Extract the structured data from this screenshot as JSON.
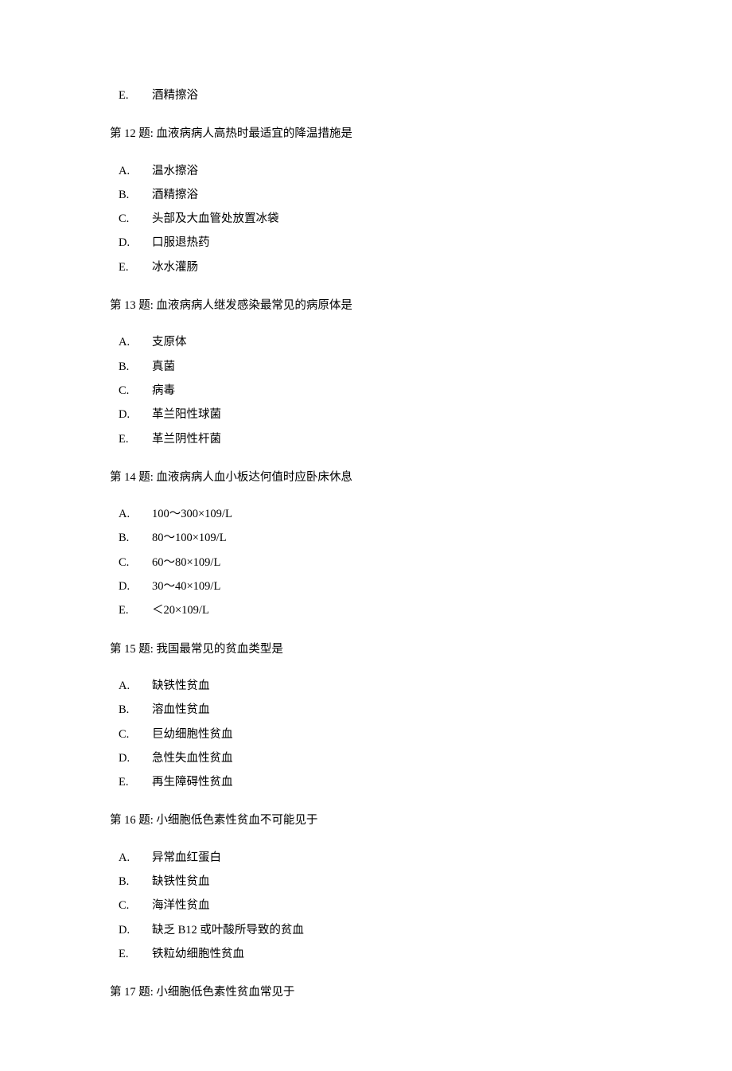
{
  "orphan": {
    "letter": "E.",
    "text": "酒精擦浴"
  },
  "questions": [
    {
      "number_prefix": "第 ",
      "number": "12",
      "number_suffix": " 题: ",
      "text": "血液病病人高热时最适宜的降温措施是",
      "options": [
        {
          "letter": "A.",
          "text": "温水擦浴"
        },
        {
          "letter": "B.",
          "text": "酒精擦浴"
        },
        {
          "letter": "C.",
          "text": "头部及大血管处放置冰袋"
        },
        {
          "letter": "D.",
          "text": "口服退热药"
        },
        {
          "letter": "E.",
          "text": "冰水灌肠"
        }
      ]
    },
    {
      "number_prefix": "第 ",
      "number": "13",
      "number_suffix": " 题: ",
      "text": "血液病病人继发感染最常见的病原体是",
      "options": [
        {
          "letter": "A.",
          "text": "支原体"
        },
        {
          "letter": "B.",
          "text": "真菌"
        },
        {
          "letter": "C.",
          "text": "病毒"
        },
        {
          "letter": "D.",
          "text": "革兰阳性球菌"
        },
        {
          "letter": "E.",
          "text": "革兰阴性杆菌"
        }
      ]
    },
    {
      "number_prefix": "第 ",
      "number": "14",
      "number_suffix": " 题: ",
      "text": "血液病病人血小板达何值时应卧床休息",
      "options": [
        {
          "letter": "A.",
          "text": "100～300×109/L"
        },
        {
          "letter": "B.",
          "text": "80～100×109/L"
        },
        {
          "letter": "C.",
          "text": "60～80×109/L"
        },
        {
          "letter": "D.",
          "text": "30～40×109/L"
        },
        {
          "letter": "E.",
          "text": "＜20×109/L"
        }
      ]
    },
    {
      "number_prefix": "第 ",
      "number": "15",
      "number_suffix": " 题: ",
      "text": "我国最常见的贫血类型是",
      "options": [
        {
          "letter": "A.",
          "text": "缺铁性贫血"
        },
        {
          "letter": "B.",
          "text": "溶血性贫血"
        },
        {
          "letter": "C.",
          "text": "巨幼细胞性贫血"
        },
        {
          "letter": "D.",
          "text": "急性失血性贫血"
        },
        {
          "letter": "E.",
          "text": "再生障碍性贫血"
        }
      ]
    },
    {
      "number_prefix": "第 ",
      "number": "16",
      "number_suffix": " 题: ",
      "text": "小细胞低色素性贫血不可能见于",
      "options": [
        {
          "letter": "A.",
          "text": "异常血红蛋白"
        },
        {
          "letter": "B.",
          "text": "缺铁性贫血"
        },
        {
          "letter": "C.",
          "text": "海洋性贫血"
        },
        {
          "letter": "D.",
          "text": "缺乏 B12 或叶酸所导致的贫血"
        },
        {
          "letter": "E.",
          "text": "铁粒幼细胞性贫血"
        }
      ]
    },
    {
      "number_prefix": "第 ",
      "number": "17",
      "number_suffix": " 题: ",
      "text": "小细胞低色素性贫血常见于",
      "options": []
    }
  ]
}
